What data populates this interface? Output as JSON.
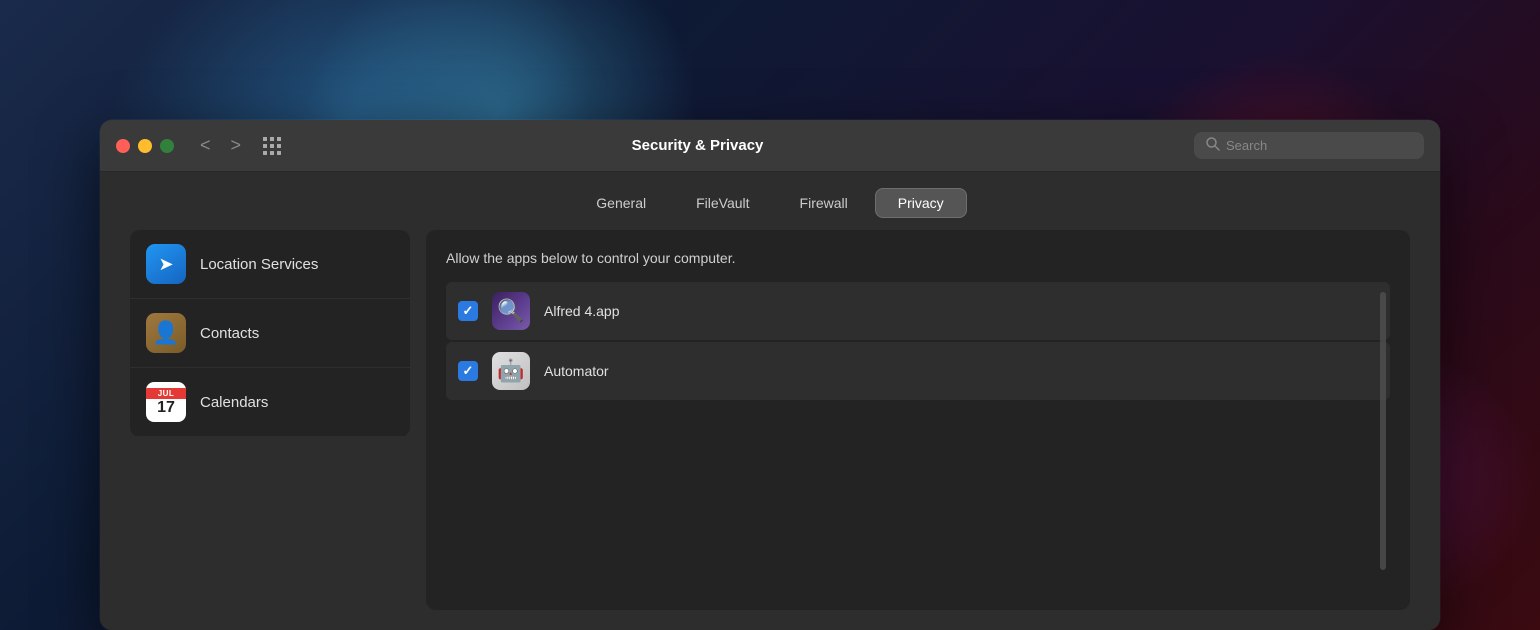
{
  "desktop": {
    "bg": "macOS Big Sur desktop background"
  },
  "window": {
    "title": "Security & Privacy",
    "traffic_lights": {
      "close": "close",
      "minimize": "minimize",
      "maximize": "maximize"
    },
    "nav": {
      "back_label": "<",
      "forward_label": ">"
    },
    "search": {
      "placeholder": "Search"
    },
    "tabs": [
      {
        "id": "general",
        "label": "General",
        "active": false
      },
      {
        "id": "filevault",
        "label": "FileVault",
        "active": false
      },
      {
        "id": "firewall",
        "label": "Firewall",
        "active": false
      },
      {
        "id": "privacy",
        "label": "Privacy",
        "active": true
      }
    ],
    "sidebar": {
      "items": [
        {
          "id": "location",
          "label": "Location Services",
          "icon": "location-icon"
        },
        {
          "id": "contacts",
          "label": "Contacts",
          "icon": "contacts-icon"
        },
        {
          "id": "calendars",
          "label": "Calendars",
          "icon": "calendar-icon"
        }
      ],
      "calendar_month": "JUL",
      "calendar_day": "17"
    },
    "right_panel": {
      "description": "Allow the apps below to control your computer.",
      "apps": [
        {
          "id": "alfred",
          "name": "Alfred 4.app",
          "checked": true
        },
        {
          "id": "automator",
          "name": "Automator",
          "checked": true
        }
      ]
    }
  }
}
